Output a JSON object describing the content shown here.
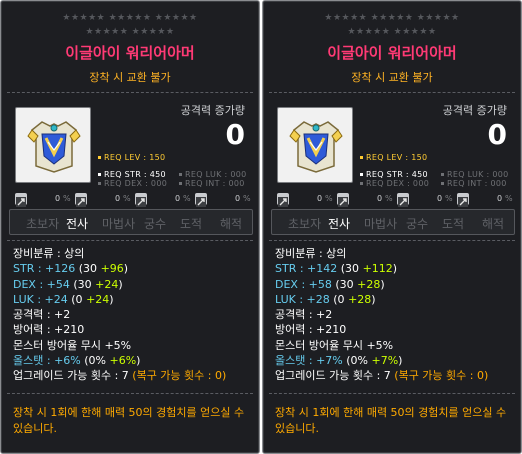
{
  "tooltips": [
    {
      "stars_row1": "★★★★★ ★★★★★ ★★★★★",
      "stars_row2": "★★★★★ ★★★★★",
      "title": "이글아이 워리어아머",
      "subtitle": "장착 시 교환 불가",
      "attack_label": "공격력 증가량",
      "attack_value": "0",
      "req_lev": "REQ LEV : 150",
      "req_str": "REQ STR : 450",
      "req_luk": "REQ LUK : 000",
      "req_dex": "REQ DEX : 000",
      "req_int": "REQ INT : 000",
      "icon_values": [
        "0",
        "0",
        "0",
        "0"
      ],
      "icon_names": [
        "sword-icon",
        "pot-icon",
        "shield-icon",
        "bag-icon"
      ],
      "jobs": [
        "초보자",
        "전사",
        "마법사",
        "궁수",
        "도적",
        "해적"
      ],
      "active_job": "전사",
      "stats": {
        "category": "장비분류 : 상의",
        "str_label": "STR : ",
        "str_total": "+126",
        "str_base": " (30 ",
        "str_bonus": "+96",
        "str_close": ")",
        "dex_label": "DEX : ",
        "dex_total": "+54",
        "dex_base": " (30 ",
        "dex_bonus": "+24",
        "dex_close": ")",
        "luk_label": "LUK : ",
        "luk_total": "+24",
        "luk_base": " (0 ",
        "luk_bonus": "+24",
        "luk_close": ")",
        "attack": "공격력 : +2",
        "defense": "방어력 : +210",
        "ignore_def": "몬스터 방어율 무시 +5%",
        "allstat_label": "올스탯 : ",
        "allstat_total": "+6%",
        "allstat_base": " (0% ",
        "allstat_bonus": "+6%",
        "allstat_close": ")",
        "upgrade_label": "업그레이드 가능 횟수 : 7 ",
        "upgrade_recover": "(복구 가능 횟수 : 0)"
      },
      "description": "장착 시 1회에 한해 매력 50의 경험치를 얻으실 수 있습니다."
    },
    {
      "stars_row1": "★★★★★ ★★★★★ ★★★★★",
      "stars_row2": "★★★★★ ★★★★★",
      "title": "이글아이 워리어아머",
      "subtitle": "장착 시 교환 불가",
      "attack_label": "공격력 증가량",
      "attack_value": "0",
      "req_lev": "REQ LEV : 150",
      "req_str": "REQ STR : 450",
      "req_luk": "REQ LUK : 000",
      "req_dex": "REQ DEX : 000",
      "req_int": "REQ INT : 000",
      "icon_values": [
        "0",
        "0",
        "0",
        "0"
      ],
      "icon_names": [
        "sword-icon",
        "pot-icon",
        "shield-icon",
        "bag-icon"
      ],
      "jobs": [
        "초보자",
        "전사",
        "마법사",
        "궁수",
        "도적",
        "해적"
      ],
      "active_job": "전사",
      "stats": {
        "category": "장비분류 : 상의",
        "str_label": "STR : ",
        "str_total": "+142",
        "str_base": " (30 ",
        "str_bonus": "+112",
        "str_close": ")",
        "dex_label": "DEX : ",
        "dex_total": "+58",
        "dex_base": " (30 ",
        "dex_bonus": "+28",
        "dex_close": ")",
        "luk_label": "LUK : ",
        "luk_total": "+28",
        "luk_base": " (0 ",
        "luk_bonus": "+28",
        "luk_close": ")",
        "attack": "공격력 : +2",
        "defense": "방어력 : +210",
        "ignore_def": "몬스터 방어율 무시 +5%",
        "allstat_label": "올스탯 : ",
        "allstat_total": "+7%",
        "allstat_base": " (0% ",
        "allstat_bonus": "+7%",
        "allstat_close": ")",
        "upgrade_label": "업그레이드 가능 횟수 : 7 ",
        "upgrade_recover": "(복구 가능 횟수 : 0)"
      },
      "description": "장착 시 1회에 한해 매력 50의 경험치를 얻으실 수 있습니다."
    }
  ],
  "colors": {
    "background": "#1d1e22",
    "title": "#ff3a75",
    "subtitle": "#ffb324",
    "stat_cyan": "#66ccee",
    "stat_bonus": "#ccff00",
    "orange": "#ffaa00",
    "req_lev": "#ffcc33"
  }
}
